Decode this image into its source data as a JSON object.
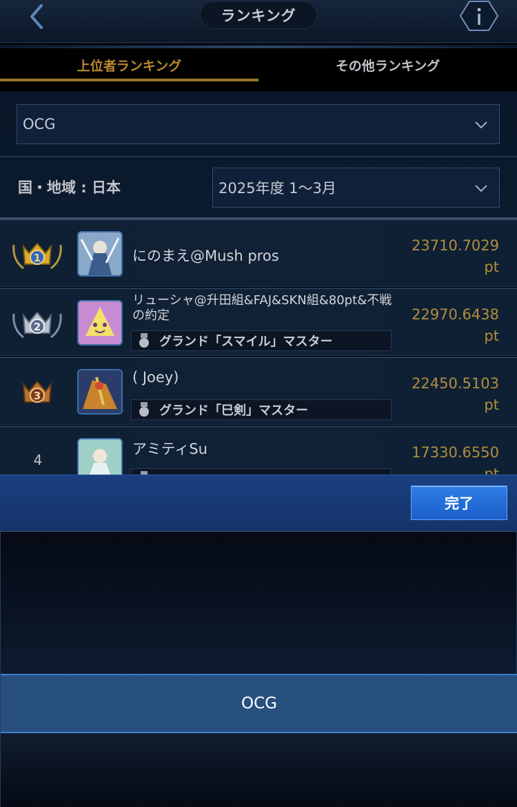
{
  "header": {
    "title": "ランキング",
    "back_icon": "chevron-left-icon",
    "info_icon": "info-hexagon-icon"
  },
  "tabs": [
    {
      "label": "上位者ランキング",
      "active": true
    },
    {
      "label": "その他ランキング",
      "active": false
    }
  ],
  "filters": {
    "format_value": "OCG",
    "region_label": "国・地域 : 日本",
    "period_value": "2025年度 1〜3月"
  },
  "rankings": [
    {
      "rank": "1",
      "name": "にのまえ@Mush pros",
      "title": "",
      "points": "23710.7029",
      "unit": "pt",
      "crown": "gold"
    },
    {
      "rank": "2",
      "name": "リューシャ@升田組&FAJ&SKN組&80pt&不戦の約定",
      "title": "グランド「スマイル」マスター",
      "points": "22970.6438",
      "unit": "pt",
      "crown": "silver"
    },
    {
      "rank": "3",
      "name": "( Joey)",
      "title": "グランド「巳剣」マスター",
      "points": "22450.5103",
      "unit": "pt",
      "crown": "bronze"
    },
    {
      "rank": "4",
      "name": "アミティSu",
      "title": "",
      "points": "17330.6550",
      "unit": "pt",
      "crown": ""
    }
  ],
  "picker": {
    "done_label": "完了",
    "selected_option": "OCG"
  },
  "colors": {
    "gold_text": "#b28d3c",
    "tab_active": "#b98a2e",
    "picker_highlight": "#27507f",
    "done_button": "#2f7ee6"
  }
}
